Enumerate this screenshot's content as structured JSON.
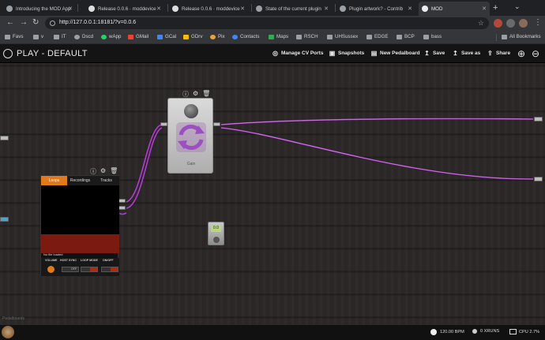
{
  "browser": {
    "tabs": [
      {
        "title": "Introducing the MOD App"
      },
      {
        "title": "Release 0.0.6 · moddevice"
      },
      {
        "title": "Release 0.0.6 · moddevice"
      },
      {
        "title": "State of the current plugin"
      },
      {
        "title": "Plugin artwork? - Contrib"
      },
      {
        "title": "MOD",
        "active": true
      }
    ],
    "url": "http://127.0.0.1:18181/?v=0.0.6",
    "bookmarks": [
      "Favs",
      "v",
      "IT",
      "Dscd",
      "wApp",
      "GMail",
      "GCal",
      "GDrv",
      "Pix",
      "Contacts",
      "Maps",
      "RSCH",
      "UHSussex",
      "EDGE",
      "BCP",
      "bass"
    ],
    "all_bookmarks": "All Bookmarks"
  },
  "app": {
    "title": "PLAY - DEFAULT",
    "header_buttons": [
      {
        "label": "Manage CV Ports",
        "icon": "cv-ports-icon"
      },
      {
        "label": "Snapshots",
        "icon": "snapshots-icon"
      },
      {
        "label": "New Pedalboard",
        "icon": "new-pedalboard-icon"
      },
      {
        "label": "Save",
        "icon": "save-icon"
      },
      {
        "label": "Save as",
        "icon": "save-as-icon"
      },
      {
        "label": "Share",
        "icon": "share-icon"
      }
    ],
    "pedal": {
      "name": "Gain"
    },
    "looper": {
      "tabs": [
        "Loops",
        "Recordings",
        "Tracks"
      ],
      "active_tab": "Loops",
      "message": "No file loaded",
      "controls": [
        "VOLUME",
        "HOST SYNC",
        "LOOP MODE",
        "ON/OFF"
      ],
      "host_sync_value": "OFF"
    },
    "tuner": {
      "display": "0.0"
    },
    "watermark": "Pedalboards"
  },
  "status": {
    "bpm": "120.00 BPM",
    "xruns": "0 XRUNS",
    "cpu": "CPU 2.7%"
  },
  "colors": {
    "cable": "#b43ad6",
    "looper_accent": "#e07a1a"
  }
}
